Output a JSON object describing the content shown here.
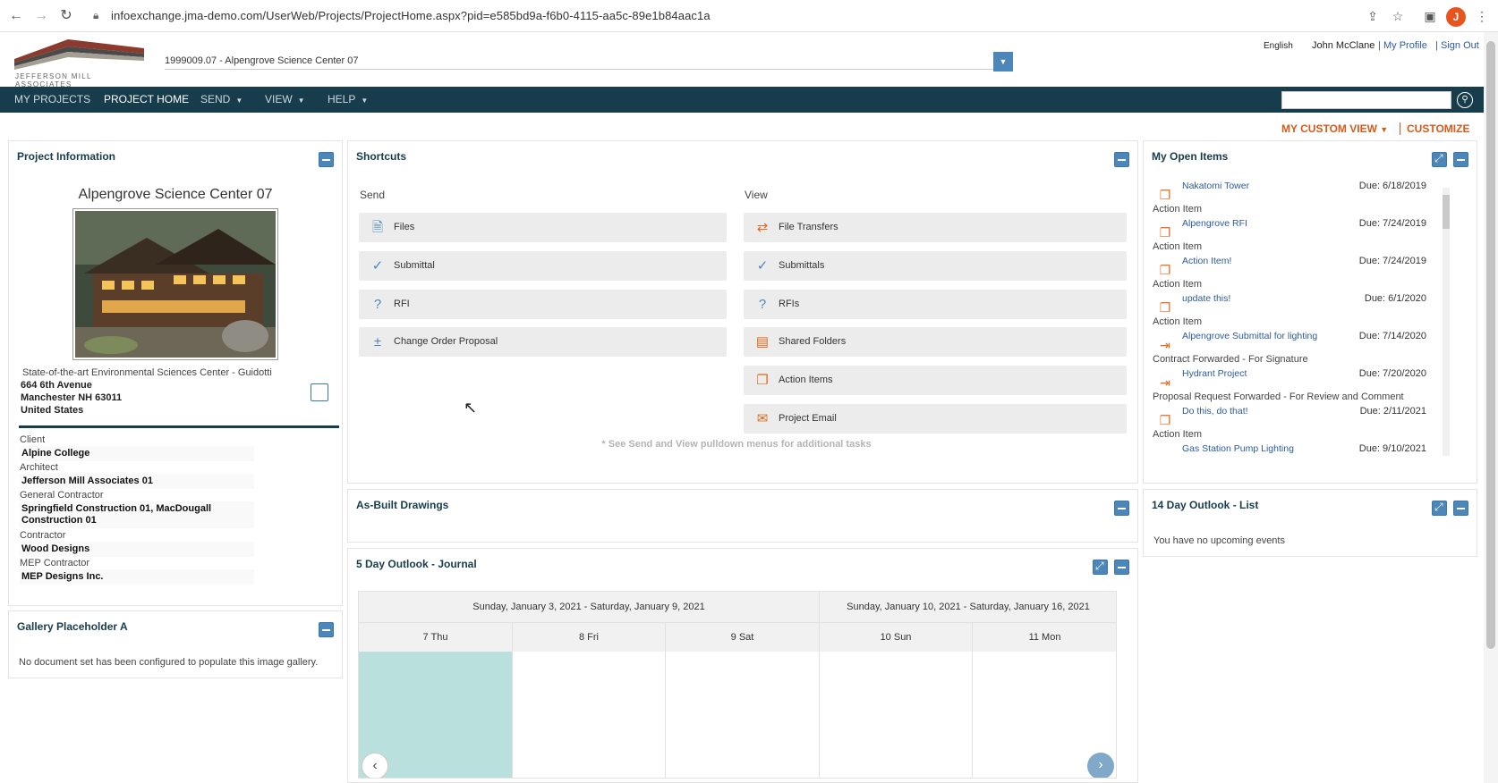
{
  "browser": {
    "url": "infoexchange.jma-demo.com/UserWeb/Projects/ProjectHome.aspx?pid=e585bd9a-f6b0-4115-aa5c-89e1b84aac1a",
    "profile_initial": "J"
  },
  "header": {
    "logo_text": "JEFFERSON MILL ASSOCIATES",
    "project_selected": "1999009.07 - Alpengrove Science Center 07",
    "language": "English",
    "user_name": "John McClane",
    "my_profile": "My Profile",
    "sign_out": "Sign Out",
    "divider": "|"
  },
  "mainnav": {
    "items": [
      "MY PROJECTS",
      "PROJECT HOME",
      "SEND",
      "VIEW",
      "HELP"
    ],
    "caret": "▼"
  },
  "viewbar": {
    "custom_view": "MY CUSTOM VIEW",
    "custom_view_caret": "▼",
    "customize": "CUSTOMIZE"
  },
  "project_info": {
    "title": "Project Information",
    "name": "Alpengrove Science Center 07",
    "description": "State-of-the-art Environmental Sciences Center - Guidotti",
    "address": [
      "664 6th Avenue",
      "Manchester NH 63011",
      "United States"
    ],
    "fields": [
      {
        "label": "Client",
        "value": "Alpine College"
      },
      {
        "label": "Architect",
        "value": "Jefferson Mill Associates 01"
      },
      {
        "label": "General Contractor",
        "value": "Springfield Construction 01, MacDougall Construction 01"
      },
      {
        "label": "Contractor",
        "value": "Wood Designs"
      },
      {
        "label": "MEP Contractor",
        "value": "MEP Designs Inc."
      }
    ]
  },
  "gallery": {
    "title": "Gallery Placeholder A",
    "message": "No document set has been configured to populate this image gallery."
  },
  "shortcuts": {
    "title": "Shortcuts",
    "send_heading": "Send",
    "view_heading": "View",
    "send": [
      "Files",
      "Submittal",
      "RFI",
      "Change Order Proposal"
    ],
    "view": [
      "File Transfers",
      "Submittals",
      "RFIs",
      "Shared Folders",
      "Action Items",
      "Project Email"
    ],
    "note": "* See Send and View pulldown menus for additional tasks"
  },
  "open_items": {
    "title": "My Open Items",
    "items": [
      {
        "name": "Nakatomi Tower",
        "due": "Due: 6/18/2019",
        "type": "Action Item"
      },
      {
        "name": "Alpengrove RFI",
        "due": "Due: 7/24/2019",
        "type": "Action Item"
      },
      {
        "name": "Action Item!",
        "due": "Due: 7/24/2019",
        "type": "Action Item"
      },
      {
        "name": "update this!",
        "due": "Due: 6/1/2020",
        "type": "Action Item"
      },
      {
        "name": "Alpengrove Submittal for lighting",
        "due": "Due: 7/14/2020",
        "type": "Contract Forwarded - For Signature"
      },
      {
        "name": "Hydrant Project",
        "due": "Due: 7/20/2020",
        "type": "Proposal Request Forwarded - For Review and Comment"
      },
      {
        "name": "Do this, do that!",
        "due": "Due: 2/11/2021",
        "type": "Action Item"
      },
      {
        "name": "Gas Station Pump Lighting",
        "due": "Due: 9/10/2021",
        "type": ""
      }
    ]
  },
  "as_built": {
    "title": "As-Built Drawings"
  },
  "outlook14": {
    "title": "14 Day Outlook - List",
    "message": "You have no upcoming events"
  },
  "journal": {
    "title": "5 Day Outlook - Journal",
    "weeks": [
      "Sunday, January 3, 2021 - Saturday, January 9, 2021",
      "Sunday, January 10, 2021 - Saturday, January 16, 2021"
    ],
    "days": [
      "7 Thu",
      "8 Fri",
      "9 Sat",
      "10 Sun",
      "11 Mon"
    ],
    "prev": "‹",
    "next": "›"
  },
  "colors": {
    "nav": "#173c4c",
    "accent": "#d45a1a",
    "button": "#4d86b8",
    "today": "#b9e0dc"
  }
}
